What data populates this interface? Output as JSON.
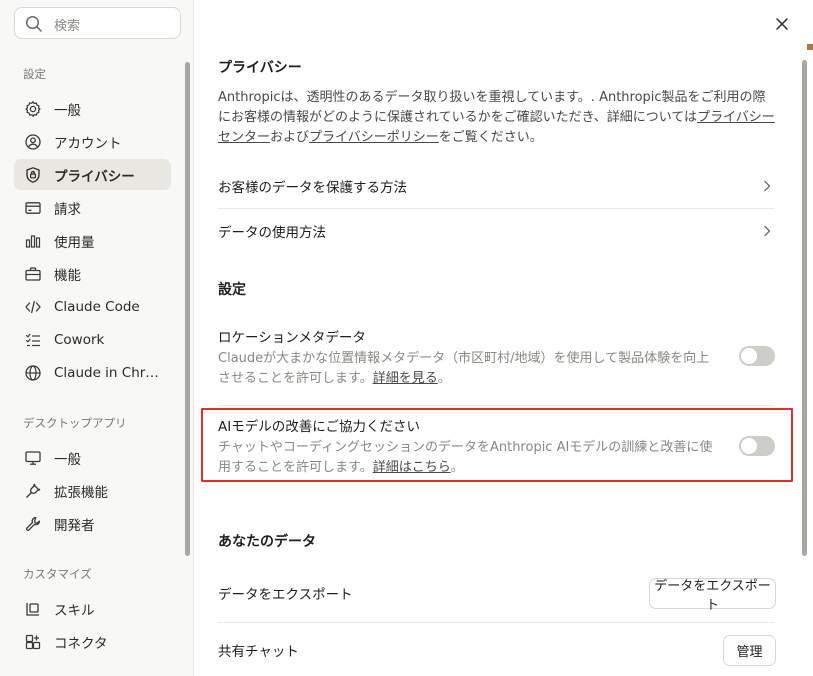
{
  "sidebar": {
    "search_placeholder": "検索",
    "sections": {
      "settings": "設定",
      "desktop": "デスクトップアプリ",
      "customize": "カスタマイズ"
    },
    "items": [
      {
        "label": "一般",
        "icon": "gear-icon"
      },
      {
        "label": "アカウント",
        "icon": "user-circle-icon"
      },
      {
        "label": "プライバシー",
        "icon": "shield-icon",
        "active": true
      },
      {
        "label": "請求",
        "icon": "credit-card-icon"
      },
      {
        "label": "使用量",
        "icon": "bar-chart-icon"
      },
      {
        "label": "機能",
        "icon": "briefcase-icon"
      },
      {
        "label": "Claude Code",
        "icon": "code-icon"
      },
      {
        "label": "Cowork",
        "icon": "checklist-icon"
      },
      {
        "label": "Claude in Chr…",
        "icon": "globe-icon"
      }
    ],
    "desktop_items": [
      {
        "label": "一般",
        "icon": "monitor-icon"
      },
      {
        "label": "拡張機能",
        "icon": "plug-icon"
      },
      {
        "label": "開発者",
        "icon": "wrench-icon"
      }
    ],
    "customize_items": [
      {
        "label": "スキル",
        "icon": "skill-icon"
      },
      {
        "label": "コネクタ",
        "icon": "connector-icon"
      }
    ]
  },
  "main": {
    "privacy": {
      "title": "プライバシー",
      "desc_prefix": "Anthropicは、透明性のあるデータ取り扱いを重視しています。. Anthropic製品をご利用の際にお客様の情報がどのように保護されているかをご確認いただき、詳細については",
      "link1": "プライバシーセンター",
      "desc_mid": "および",
      "link2": "プライバシーポリシー",
      "desc_suffix": "をご覧ください。"
    },
    "rows": [
      {
        "label": "お客様のデータを保護する方法"
      },
      {
        "label": "データの使用方法"
      }
    ],
    "settings_title": "設定",
    "location": {
      "title": "ロケーションメタデータ",
      "desc": "Claudeが大まかな位置情報メタデータ（市区町村/地域）を使用して製品体験を向上させることを許可します。",
      "link": "詳細を見る",
      "suffix": "。",
      "enabled": false
    },
    "improve": {
      "title": "AIモデルの改善にご協力ください",
      "desc": "チャットやコーディングセッションのデータをAnthropic AIモデルの訓練と改善に使用することを許可します。",
      "link": "詳細はこちら",
      "suffix": "。",
      "enabled": false
    },
    "your_data_title": "あなたのデータ",
    "export": {
      "label": "データをエクスポート",
      "button": "データをエクスポート"
    },
    "shared": {
      "label": "共有チャット",
      "button": "管理"
    }
  },
  "colors": {
    "highlight": "#d9342b",
    "active_bg": "#e9e7e2",
    "toggle_off": "#cfcdc8"
  }
}
